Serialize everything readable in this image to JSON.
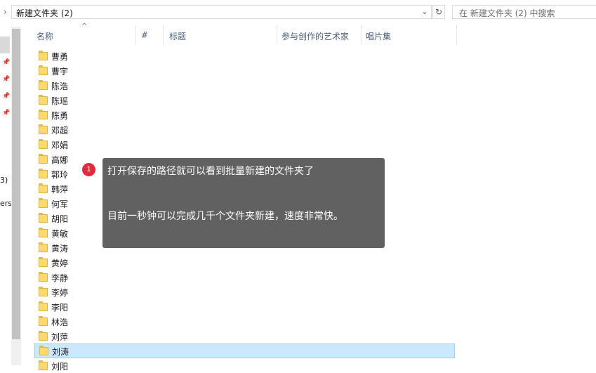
{
  "address": {
    "path": "新建文件夹 (2)"
  },
  "search": {
    "placeholder": "在 新建文件夹 (2) 中搜索"
  },
  "nav": {
    "fragments": [
      "3)",
      "erso"
    ]
  },
  "columns": [
    {
      "label": "名称"
    },
    {
      "label": "#"
    },
    {
      "label": "标题"
    },
    {
      "label": "参与创作的艺术家"
    },
    {
      "label": "唱片集"
    }
  ],
  "files": [
    "曹勇",
    "曹宇",
    "陈浩",
    "陈瑶",
    "陈勇",
    "邓超",
    "邓娟",
    "高娜",
    "郭玲",
    "韩萍",
    "何军",
    "胡阳",
    "黄敏",
    "黄涛",
    "黄婷",
    "李静",
    "李婷",
    "李阳",
    "林浩",
    "刘萍",
    "刘涛",
    "刘阳"
  ],
  "selected_file": "刘涛",
  "tooltip": {
    "step": "1",
    "line1": "打开保存的路径就可以看到批量新建的文件夹了",
    "line2": "目前一秒钟可以完成几千个文件夹新建，速度非常快。"
  },
  "colors": {
    "tooltip_bg": "#616161",
    "badge": "#e8283a",
    "selection_bg": "#cce8ff",
    "folder": "#ffd86e"
  }
}
